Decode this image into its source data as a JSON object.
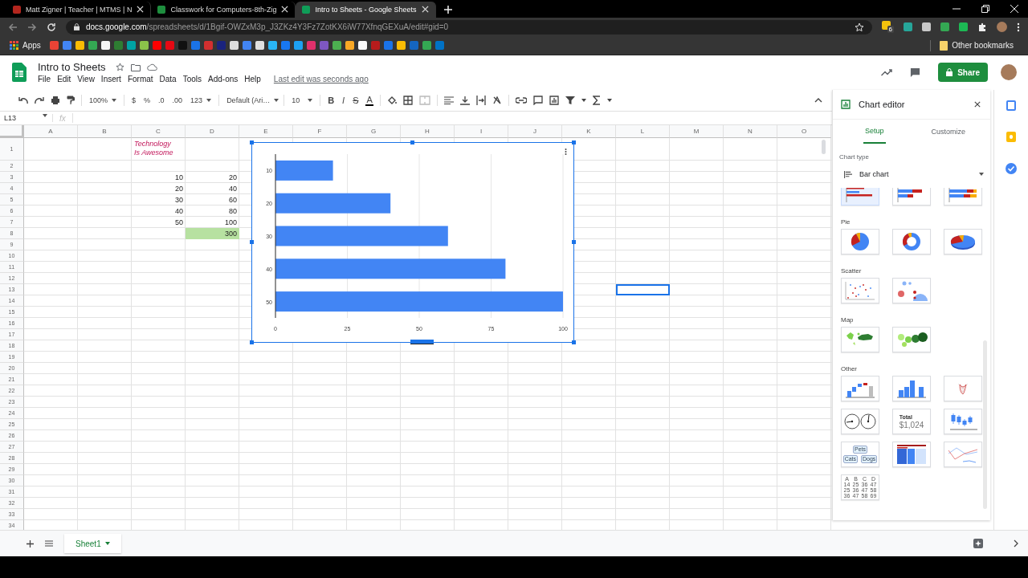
{
  "browser": {
    "tabs": [
      {
        "title": "Matt Zigner | Teacher | MTMS | N",
        "selected": false,
        "color": "#b3261e"
      },
      {
        "title": "Classwork for Computers-8th-Zig",
        "selected": false,
        "color": "#1e8e3e"
      },
      {
        "title": "Intro to Sheets - Google Sheets",
        "selected": true,
        "color": "#0f9d58"
      }
    ],
    "url_host": "docs.google.com",
    "url_path": "/spreadsheets/d/1Bgif-OWZxM3p_J3ZKz4Y3Fz7ZotKX6iW77XfnqGEXuA/edit#gid=0",
    "extensions": [
      {
        "color": "#f4c20d",
        "badge": "6"
      },
      {
        "color": "#26a69a"
      },
      {
        "color": "#c8c8c8"
      },
      {
        "color": "#34a853"
      },
      {
        "color": "#1db954"
      }
    ],
    "apps_label": "Apps",
    "bookmarks": [
      {
        "color": "#ea4335"
      },
      {
        "color": "#4285f4"
      },
      {
        "color": "#fbbc04"
      },
      {
        "color": "#34a853"
      },
      {
        "color": "#f5f5f5"
      },
      {
        "color": "#2e7d32"
      },
      {
        "color": "#00a3a3"
      },
      {
        "color": "#8bc34a"
      },
      {
        "color": "#ff0000"
      },
      {
        "color": "#e50914"
      },
      {
        "color": "#111111"
      },
      {
        "color": "#1a73e8"
      },
      {
        "color": "#d32f2f"
      },
      {
        "color": "#1a237e"
      },
      {
        "color": "#dddddd"
      },
      {
        "color": "#4285f4"
      },
      {
        "color": "#e0e0e0"
      },
      {
        "color": "#29b6f6"
      },
      {
        "color": "#1877f2"
      },
      {
        "color": "#1da1f2"
      },
      {
        "color": "#e1306c"
      },
      {
        "color": "#7e57c2"
      },
      {
        "color": "#4caf50"
      },
      {
        "color": "#f9a825"
      },
      {
        "color": "#fafafa"
      },
      {
        "color": "#b71c1c"
      },
      {
        "color": "#1a73e8"
      },
      {
        "color": "#fbbc04"
      },
      {
        "color": "#1565c0"
      },
      {
        "color": "#34a853"
      },
      {
        "color": "#0072c6"
      }
    ],
    "other_bookmarks": "Other bookmarks"
  },
  "document": {
    "title": "Intro to Sheets",
    "menus": [
      "File",
      "Edit",
      "View",
      "Insert",
      "Format",
      "Data",
      "Tools",
      "Add-ons",
      "Help"
    ],
    "last_edit": "Last edit was seconds ago",
    "share": "Share"
  },
  "toolbar": {
    "zoom": "100%",
    "currency": "$",
    "percent": "%",
    "decrease_decimals": ".0",
    "increase_decimals": ".00",
    "more_formats": "123",
    "font": "Default (Ari…",
    "font_size": "10",
    "bold": "B",
    "italic": "I",
    "strikethrough": "S",
    "text_color": "A"
  },
  "formula_bar": {
    "name_box": "L13",
    "fx": "fx"
  },
  "sheet": {
    "columns": [
      "A",
      "B",
      "C",
      "D",
      "E",
      "F",
      "G",
      "H",
      "I",
      "J",
      "K",
      "L",
      "M",
      "N",
      "O"
    ],
    "rows": [
      {
        "label": "1",
        "c": {
          "text": "Technology\nIs Awesome",
          "kind": "label",
          "selected": false
        }
      },
      {
        "label": "2"
      },
      {
        "label": "3",
        "c": {
          "text": "10",
          "kind": "number",
          "selected": false
        },
        "d": {
          "text": "20",
          "kind": "number",
          "selected": false,
          "highlighted": false
        }
      },
      {
        "label": "4",
        "c": {
          "text": "20",
          "kind": "number",
          "selected": false
        },
        "d": {
          "text": "40",
          "kind": "number",
          "selected": false,
          "highlighted": false
        }
      },
      {
        "label": "5",
        "c": {
          "text": "30",
          "kind": "number",
          "selected": false
        },
        "d": {
          "text": "60",
          "kind": "number",
          "selected": false,
          "highlighted": false
        }
      },
      {
        "label": "6",
        "c": {
          "text": "40",
          "kind": "number",
          "selected": false
        },
        "d": {
          "text": "80",
          "kind": "number",
          "selected": false,
          "highlighted": false
        }
      },
      {
        "label": "7",
        "c": {
          "text": "50",
          "kind": "number",
          "selected": false
        },
        "d": {
          "text": "100",
          "kind": "number",
          "selected": false,
          "highlighted": false
        }
      },
      {
        "label": "8",
        "d": {
          "text": "300",
          "kind": "number",
          "selected": false,
          "highlighted": true
        }
      },
      {
        "label": "9"
      },
      {
        "label": "10"
      },
      {
        "label": "11"
      },
      {
        "label": "12"
      },
      {
        "label": "13",
        "l": {
          "selected": true
        }
      },
      {
        "label": "14"
      },
      {
        "label": "15"
      },
      {
        "label": "16"
      },
      {
        "label": "17"
      },
      {
        "label": "18"
      },
      {
        "label": "19"
      },
      {
        "label": "20"
      },
      {
        "label": "21"
      },
      {
        "label": "22"
      },
      {
        "label": "23"
      },
      {
        "label": "24"
      },
      {
        "label": "25"
      },
      {
        "label": "26"
      },
      {
        "label": "27"
      },
      {
        "label": "28"
      },
      {
        "label": "29"
      },
      {
        "label": "30"
      },
      {
        "label": "31"
      },
      {
        "label": "32"
      },
      {
        "label": "33"
      },
      {
        "label": "34"
      }
    ],
    "chart": {
      "chart_data": {
        "type": "bar",
        "orientation": "horizontal",
        "categories": [
          "10",
          "20",
          "30",
          "40",
          "50"
        ],
        "series": [
          {
            "color": "#4285f4",
            "values": [
              20,
              40,
              60,
              80,
              100
            ]
          }
        ],
        "xlim": [
          0,
          100
        ],
        "xticks": [
          0,
          25,
          50,
          75,
          100
        ],
        "grid": true
      }
    }
  },
  "sheet_tabs": [
    {
      "label": "Sheet1",
      "selected": true
    }
  ],
  "chart_editor": {
    "title": "Chart editor",
    "tabs": [
      {
        "label": "Setup",
        "selected": true
      },
      {
        "label": "Customize",
        "selected": false
      }
    ],
    "chart_type_label": "Chart type",
    "chart_type": "Bar chart",
    "sections": [
      {
        "thumbnails": [
          {
            "kind": "bar-clustered",
            "selected": true
          },
          {
            "kind": "bar-stacked",
            "selected": false
          },
          {
            "kind": "bar-stacked-full",
            "selected": false
          }
        ]
      },
      {
        "title": "Pie",
        "thumbnails": [
          {
            "kind": "pie",
            "selected": false
          },
          {
            "kind": "donut",
            "selected": false
          },
          {
            "kind": "pie-3d",
            "selected": false
          }
        ]
      },
      {
        "title": "Scatter",
        "thumbnails": [
          {
            "kind": "scatter",
            "selected": false
          },
          {
            "kind": "bubble",
            "selected": false
          }
        ]
      },
      {
        "title": "Map",
        "thumbnails": [
          {
            "kind": "geo",
            "selected": false
          },
          {
            "kind": "geo-markers",
            "selected": false
          }
        ]
      },
      {
        "title": "Other",
        "thumbnails": [
          {
            "kind": "waterfall",
            "selected": false
          },
          {
            "kind": "histogram",
            "selected": false
          },
          {
            "kind": "radar",
            "selected": false
          },
          {
            "kind": "gauge",
            "selected": false
          },
          {
            "kind": "scorecard",
            "selected": false,
            "label": "Total",
            "value": "$1,024"
          },
          {
            "kind": "candlestick",
            "selected": false
          },
          {
            "kind": "org",
            "selected": false,
            "nodes": [
              "Pets",
              "Cats",
              "Dogs"
            ]
          },
          {
            "kind": "treemap",
            "selected": false
          },
          {
            "kind": "timeline",
            "selected": false
          },
          {
            "kind": "table",
            "selected": false,
            "header": [
              "A",
              "B",
              "C",
              "D"
            ],
            "rows": [
              [
                "14",
                "25",
                "36",
                "47"
              ],
              [
                "25",
                "36",
                "47",
                "58"
              ],
              [
                "36",
                "47",
                "58",
                "69"
              ]
            ]
          }
        ]
      }
    ]
  }
}
